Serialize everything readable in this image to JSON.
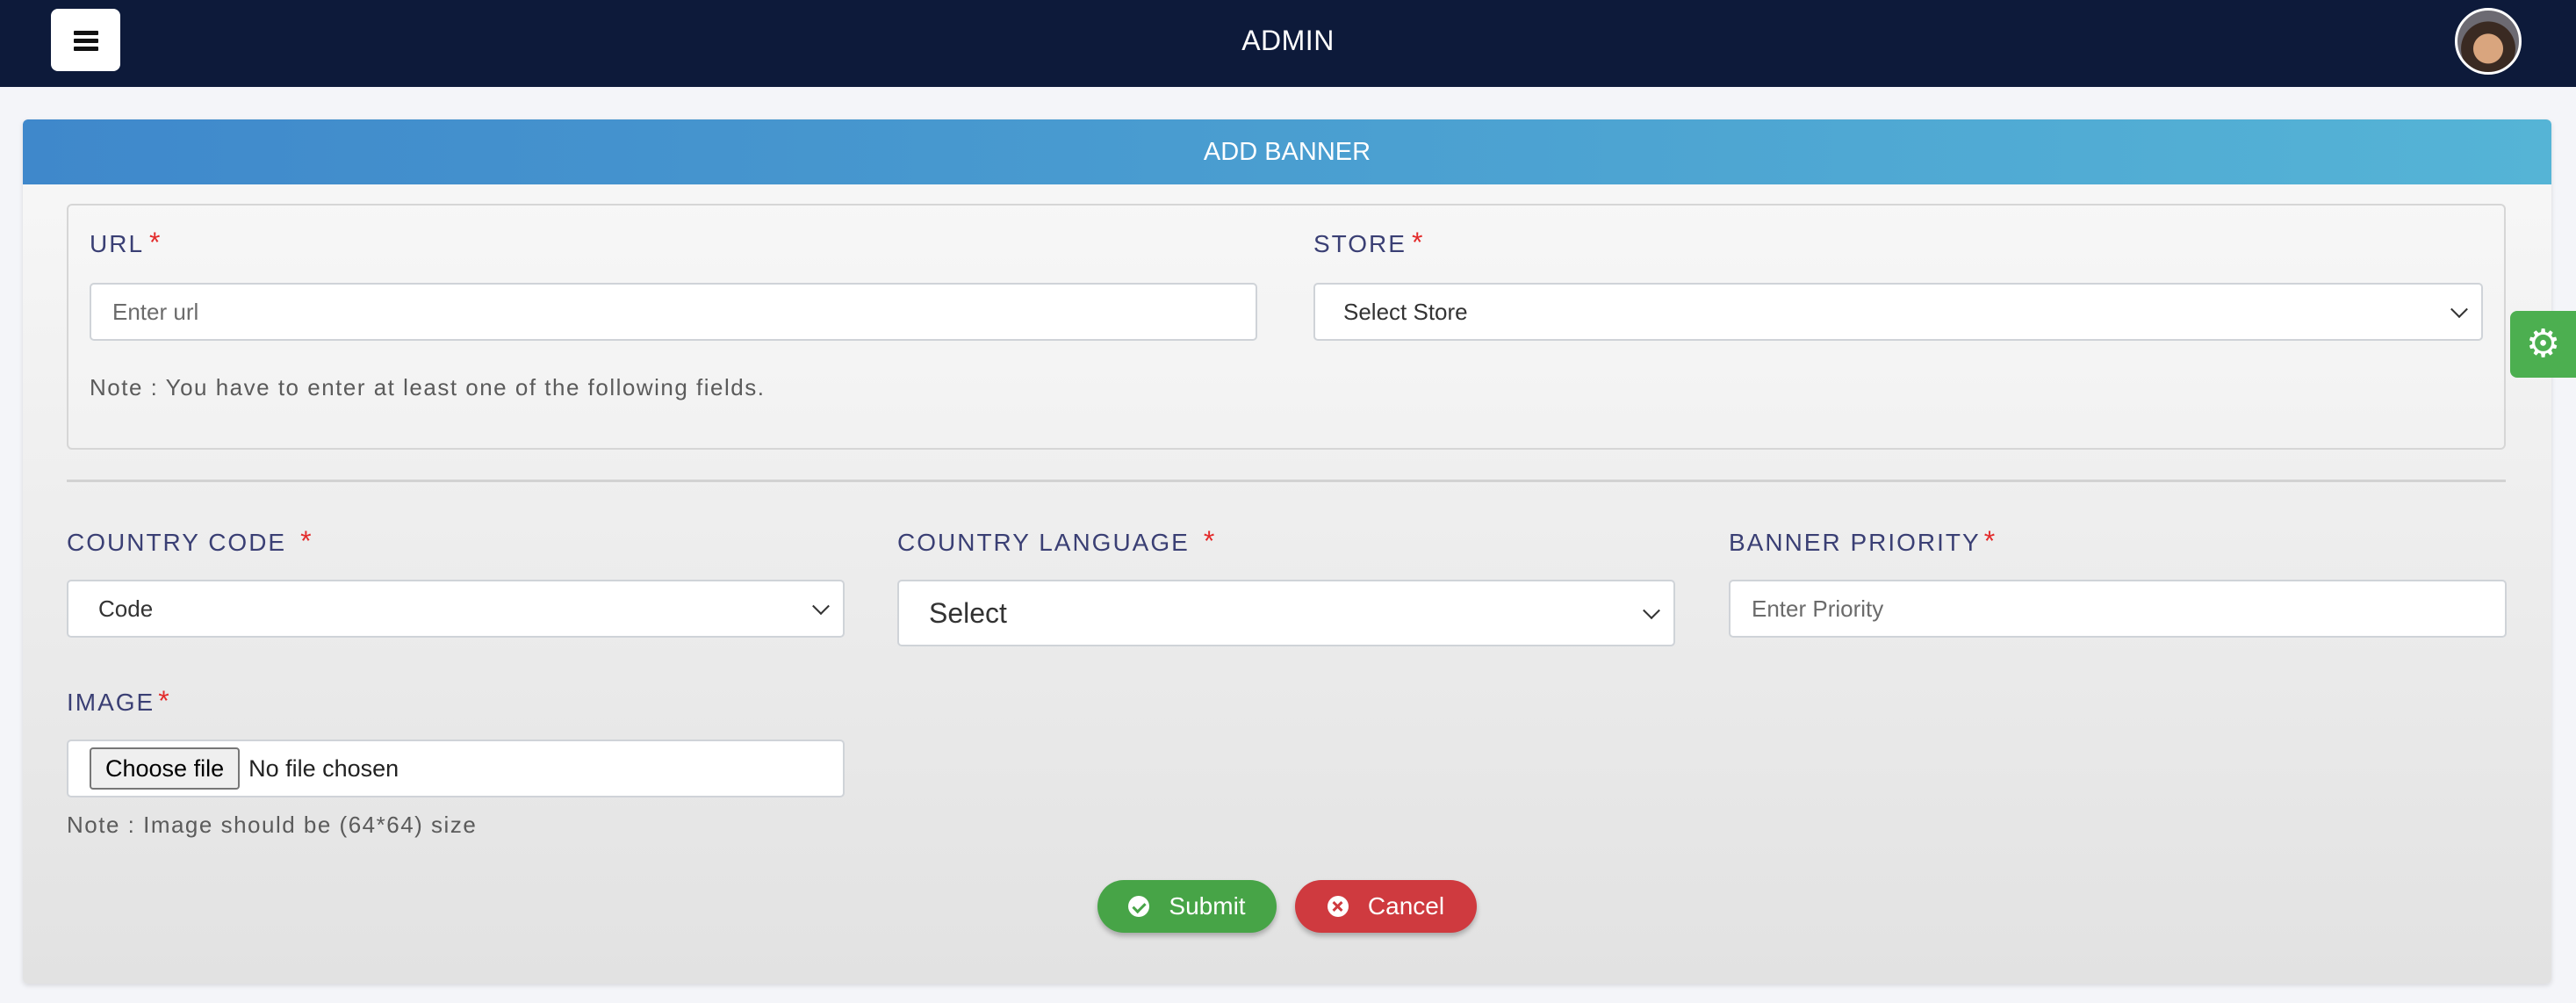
{
  "topbar": {
    "title": "ADMIN",
    "menu_icon": "hamburger-icon",
    "avatar_icon": "user-avatar"
  },
  "form": {
    "header": "ADD BANNER",
    "url": {
      "label": "URL",
      "required_mark": "*",
      "placeholder": "Enter url",
      "value": ""
    },
    "store": {
      "label": "STORE",
      "required_mark": "*",
      "selected": "Select Store"
    },
    "fields_note": "Note : You have to enter at least one of the following fields.",
    "country_code": {
      "label": "COUNTRY CODE",
      "required_mark": "*",
      "selected": "Code"
    },
    "country_language": {
      "label": "COUNTRY LANGUAGE",
      "required_mark": "*",
      "selected": "Select"
    },
    "banner_priority": {
      "label": "BANNER PRIORITY",
      "required_mark": "*",
      "placeholder": "Enter Priority",
      "value": ""
    },
    "image": {
      "label": "IMAGE",
      "required_mark": "*",
      "choose_label": "Choose file",
      "status": "No file chosen",
      "note": "Note : Image should be (64*64) size"
    },
    "submit_label": "Submit",
    "cancel_label": "Cancel"
  },
  "settings_tab": {
    "icon": "gear-icon"
  },
  "colors": {
    "topbar": "#0d1a3a",
    "header_start": "#3f88cb",
    "header_end": "#55b4d6",
    "submit": "#47a447",
    "cancel": "#cf3a3f",
    "label": "#3a3f74",
    "required": "#e32b2b",
    "settings": "#4caf50"
  }
}
